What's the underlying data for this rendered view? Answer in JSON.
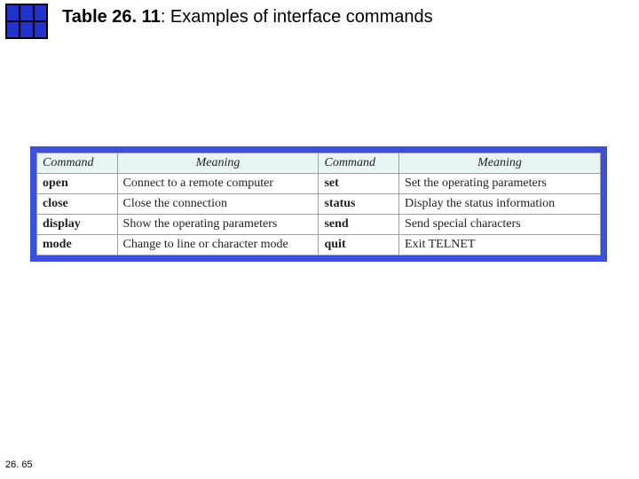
{
  "title": {
    "prefix": "Table 26. 11",
    "rest": ": Examples of interface commands"
  },
  "headers": {
    "c1": "Command",
    "c2": "Meaning",
    "c3": "Command",
    "c4": "Meaning"
  },
  "rows": [
    {
      "cmd1": "open",
      "m1": "Connect to a remote computer",
      "cmd2": "set",
      "m2": "Set the operating parameters"
    },
    {
      "cmd1": "close",
      "m1": "Close the connection",
      "cmd2": "status",
      "m2": "Display the status information"
    },
    {
      "cmd1": "display",
      "m1": "Show the operating parameters",
      "cmd2": "send",
      "m2": "Send special characters"
    },
    {
      "cmd1": "mode",
      "m1": "Change to line or character mode",
      "cmd2": "quit",
      "m2": "Exit TELNET"
    }
  ],
  "page": "26. 65"
}
